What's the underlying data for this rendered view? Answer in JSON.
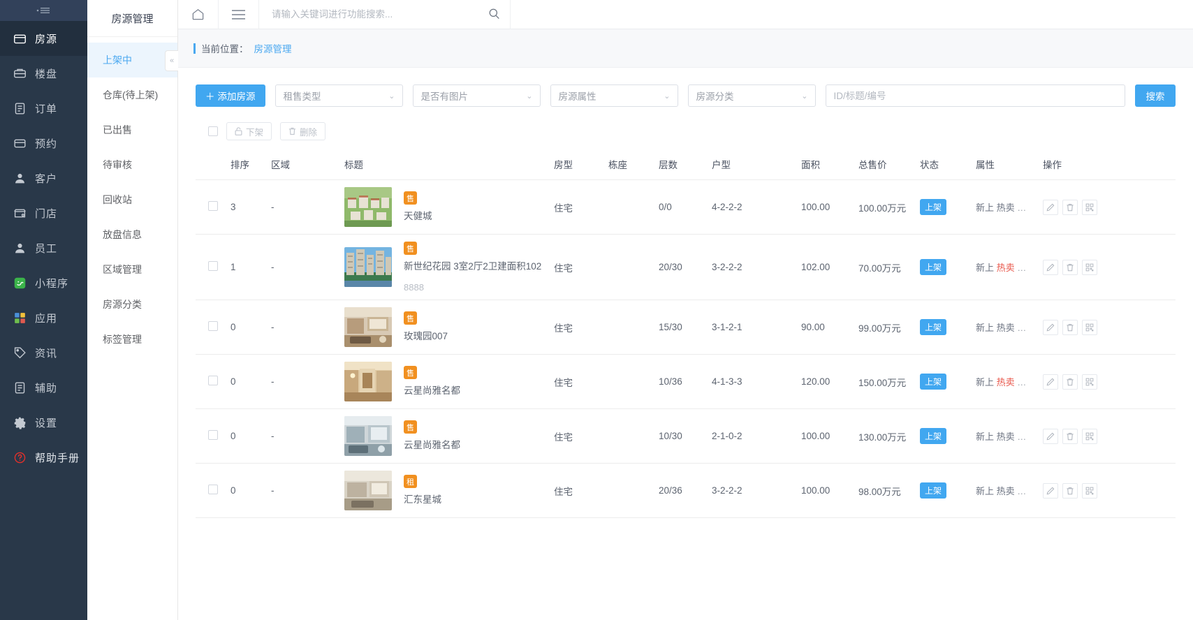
{
  "sidebar": {
    "collapse_icon": "collapse-menu-icon",
    "items": [
      {
        "label": "房源",
        "icon": "house-icon",
        "active": true
      },
      {
        "label": "楼盘",
        "icon": "building-icon",
        "active": false
      },
      {
        "label": "订单",
        "icon": "order-doc-icon",
        "active": false
      },
      {
        "label": "预约",
        "icon": "calendar-icon",
        "active": false
      },
      {
        "label": "客户",
        "icon": "user-icon",
        "active": false
      },
      {
        "label": "门店",
        "icon": "shop-icon",
        "active": false
      },
      {
        "label": "员工",
        "icon": "staff-icon",
        "active": false
      },
      {
        "label": "小程序",
        "icon": "mini-program-icon",
        "active": false
      },
      {
        "label": "应用",
        "icon": "apps-grid-icon",
        "active": false
      },
      {
        "label": "资讯",
        "icon": "news-tag-icon",
        "active": false
      },
      {
        "label": "辅助",
        "icon": "assist-doc-icon",
        "active": false
      },
      {
        "label": "设置",
        "icon": "gear-icon",
        "active": false
      },
      {
        "label": "帮助手册",
        "icon": "help-circle-icon",
        "active": false
      }
    ]
  },
  "subnav": {
    "title": "房源管理",
    "collapse_label": "«",
    "items": [
      {
        "label": "上架中",
        "active": true
      },
      {
        "label": "仓库(待上架)",
        "active": false
      },
      {
        "label": "已出售",
        "active": false
      },
      {
        "label": "待审核",
        "active": false
      },
      {
        "label": "回收站",
        "active": false
      },
      {
        "label": "放盘信息",
        "active": false
      },
      {
        "label": "区域管理",
        "active": false
      },
      {
        "label": "房源分类",
        "active": false
      },
      {
        "label": "标签管理",
        "active": false
      }
    ]
  },
  "topbar": {
    "home_icon": "home-icon",
    "menu_icon": "hamburger-menu-icon",
    "search_placeholder": "请输入关键词进行功能搜索...",
    "search_value": "",
    "search_icon": "search-icon"
  },
  "breadcrumb": {
    "prefix": "当前位置：",
    "current": "房源管理"
  },
  "filters": {
    "add_label": "添加房源",
    "add_icon": "plus-icon",
    "selects": [
      {
        "placeholder": "租售类型",
        "value": ""
      },
      {
        "placeholder": "是否有图片",
        "value": ""
      },
      {
        "placeholder": "房源属性",
        "value": ""
      },
      {
        "placeholder": "房源分类",
        "value": ""
      }
    ],
    "keyword_placeholder": "ID/标题/编号",
    "keyword_value": "",
    "search_label": "搜索"
  },
  "bulkbar": {
    "unlist_label": "下架",
    "unlist_icon": "unlock-icon",
    "delete_label": "删除",
    "delete_icon": "trash-icon"
  },
  "table": {
    "columns": [
      "排序",
      "区域",
      "标题",
      "房型",
      "栋座",
      "层数",
      "户型",
      "面积",
      "总售价",
      "状态",
      "属性",
      "操作"
    ],
    "op_icons": [
      "edit-pencil-icon",
      "trash-icon",
      "qrcode-icon"
    ],
    "rows": [
      {
        "sort": "3",
        "area": "-",
        "tag": "售",
        "tag_type": "sale",
        "title": "天健城",
        "code": "",
        "room_type": "住宅",
        "building": "",
        "floor": "0/0",
        "layout": "4-2-2-2",
        "size": "100.00",
        "price": "100.00万元",
        "state": "上架",
        "attrs": [
          "新上",
          "热卖"
        ],
        "attrs_hot": false,
        "thumb": "aerial-residential-complex"
      },
      {
        "sort": "1",
        "area": "-",
        "tag": "售",
        "tag_type": "sale",
        "title": "新世纪花园 3室2厅2卫建面积102",
        "code": "8888",
        "room_type": "住宅",
        "building": "",
        "floor": "20/30",
        "layout": "3-2-2-2",
        "size": "102.00",
        "price": "70.00万元",
        "state": "上架",
        "attrs": [
          "新上",
          "热卖"
        ],
        "attrs_hot": true,
        "thumb": "highrise-towers"
      },
      {
        "sort": "0",
        "area": "-",
        "tag": "售",
        "tag_type": "sale",
        "title": "玫瑰园007",
        "code": "",
        "room_type": "住宅",
        "building": "",
        "floor": "15/30",
        "layout": "3-1-2-1",
        "size": "90.00",
        "price": "99.00万元",
        "state": "上架",
        "attrs": [
          "新上",
          "热卖"
        ],
        "attrs_hot": false,
        "thumb": "living-room-interior"
      },
      {
        "sort": "0",
        "area": "-",
        "tag": "售",
        "tag_type": "sale",
        "title": "云星尚雅名都",
        "code": "",
        "room_type": "住宅",
        "building": "",
        "floor": "10/36",
        "layout": "4-1-3-3",
        "size": "120.00",
        "price": "150.00万元",
        "state": "上架",
        "attrs": [
          "新上",
          "热卖"
        ],
        "attrs_hot": true,
        "thumb": "warm-corridor-interior"
      },
      {
        "sort": "0",
        "area": "-",
        "tag": "售",
        "tag_type": "sale",
        "title": "云星尚雅名都",
        "code": "",
        "room_type": "住宅",
        "building": "",
        "floor": "10/30",
        "layout": "2-1-0-2",
        "size": "100.00",
        "price": "130.00万元",
        "state": "上架",
        "attrs": [
          "新上",
          "热卖"
        ],
        "attrs_hot": false,
        "thumb": "modern-living-room"
      },
      {
        "sort": "0",
        "area": "-",
        "tag": "租",
        "tag_type": "rent",
        "title": "汇东星城",
        "code": "",
        "room_type": "住宅",
        "building": "",
        "floor": "20/36",
        "layout": "3-2-2-2",
        "size": "100.00",
        "price": "98.00万元",
        "state": "上架",
        "attrs": [
          "新上",
          "热卖"
        ],
        "attrs_hot": false,
        "thumb": "bedroom-interior"
      }
    ]
  },
  "colors": {
    "accent": "#41a7f0",
    "sidebar_bg": "#293849",
    "sidebar_active": "#222f3e",
    "tag_orange": "#f19020",
    "hot_red": "#e8564a"
  }
}
